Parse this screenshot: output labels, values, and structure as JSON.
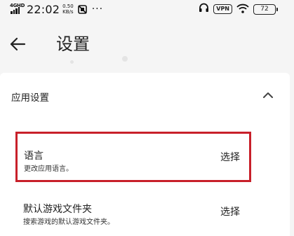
{
  "status_bar": {
    "network_type": "4GHD",
    "time": "22:02",
    "speed_value": "0.50",
    "speed_unit": "KB/s",
    "more_indicator": "···",
    "vpn_label": "VPN",
    "battery_level": "72"
  },
  "header": {
    "title": "设置"
  },
  "section": {
    "title": "应用设置"
  },
  "settings": [
    {
      "title": "语言",
      "description": "更改应用语言。",
      "action": "选择"
    },
    {
      "title": "默认游戏文件夹",
      "description": "搜索游戏的默认游戏文件夹。",
      "action": "选择"
    }
  ],
  "colors": {
    "highlight_border": "#c8202a",
    "background": "#f5f5f5",
    "card": "#ffffff"
  }
}
